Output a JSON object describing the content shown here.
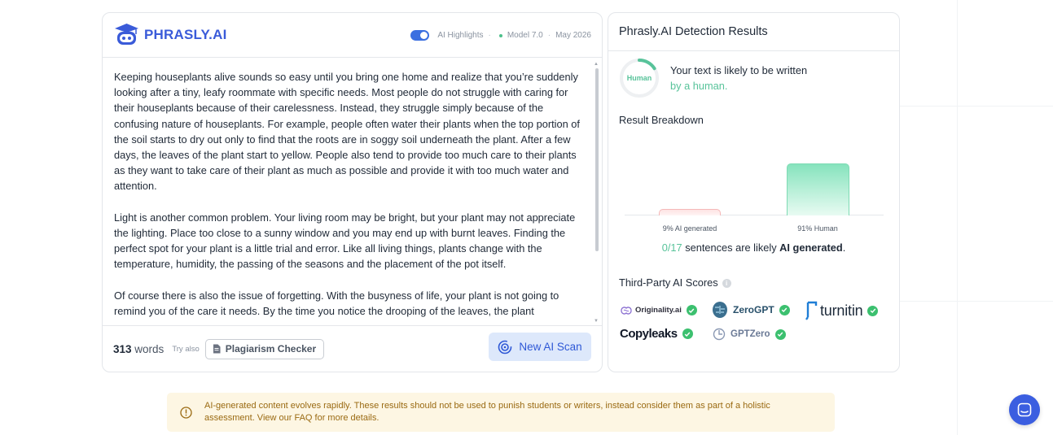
{
  "brand": {
    "name": "PHRASLY.AI",
    "primary": "#3a5bd9",
    "success": "#58c39a"
  },
  "editor": {
    "ai_highlights_label": "AI Highlights",
    "ai_highlights_on": true,
    "model_label": "Model 7.0",
    "date_label": "May 2026",
    "paragraphs": [
      "Keeping houseplants alive sounds so easy until you bring one home and realize that you’re suddenly looking after a tiny, leafy roommate with specific needs. Most people do not struggle with caring for their houseplants because of their carelessness. Instead, they struggle simply because of the confusing nature of houseplants. For example, people often water their plants when the top portion of the soil starts to dry out only to find that the roots are in soggy soil underneath the plant. After a few days, the leaves of the plant start to yellow. People also tend to provide too much care to their plants as they want to take care of their plant as much as possible and provide it with too much water and attention.",
      "Light is another common problem. Your living room may be bright, but your plant may not appreciate the lighting. Place too close to a sunny window and you may end up with burnt leaves. Finding the perfect spot for your plant is a little trial and error. Like all living things, plants change with the temperature, humidity, the passing of the seasons and the placement of the pot itself.",
      "Of course there is also the issue of forgetting. With the busyness of life, your plant is not going to remind you of the care it needs. By the time you notice the drooping of the leaves, the plant"
    ],
    "word_count": "313",
    "words_label": "words",
    "try_also_label": "Try also",
    "plagiarism_button": "Plagiarism Checker",
    "scan_button": "New AI Scan"
  },
  "results": {
    "title": "Phrasly.AI Detection Results",
    "ring_label": "Human",
    "human_fraction": 0.91,
    "verdict_line1": "Your text is likely to be written",
    "verdict_line2": "by a human.",
    "breakdown_title": "Result Breakdown",
    "ai_bar_label": "9% AI generated",
    "human_bar_label": "91% Human",
    "ai_fraction": 0.09,
    "sentences_count": "0/17",
    "sentences_mid": " sentences are likely ",
    "sentences_bold": "AI generated",
    "sentences_end": ".",
    "third_party_title": "Third-Party AI Scores",
    "providers": [
      {
        "name": "Originality.ai",
        "passed": true
      },
      {
        "name": "ZeroGPT",
        "passed": true
      },
      {
        "name": "turnitin",
        "passed": true
      },
      {
        "name": "Copyleaks",
        "passed": true
      },
      {
        "name": "GPTZero",
        "passed": true
      }
    ]
  },
  "disclaimer": {
    "text": "AI-generated content evolves rapidly. These results should not be used to punish students or writers, instead consider them as part of a holistic assessment. View our FAQ for more details."
  }
}
